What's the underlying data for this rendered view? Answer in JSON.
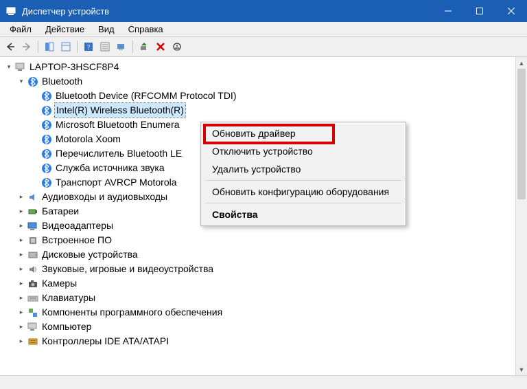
{
  "window": {
    "title": "Диспетчер устройств"
  },
  "menu": {
    "file": "Файл",
    "action": "Действие",
    "view": "Вид",
    "help": "Справка"
  },
  "tree": {
    "root": "LAPTOP-3HSCF8P4",
    "bluetooth": {
      "label": "Bluetooth",
      "children": [
        "Bluetooth Device (RFCOMM Protocol TDI)",
        "Intel(R) Wireless Bluetooth(R)",
        "Microsoft Bluetooth Enumera",
        "Motorola Xoom",
        "Перечислитель Bluetooth LE",
        "Служба источника звука",
        "Транспорт AVRCP Motorola"
      ]
    },
    "categories": [
      "Аудиовходы и аудиовыходы",
      "Батареи",
      "Видеоадаптеры",
      "Встроенное ПО",
      "Дисковые устройства",
      "Звуковые, игровые и видеоустройства",
      "Камеры",
      "Клавиатуры",
      "Компоненты программного обеспечения",
      "Компьютер",
      "Контроллеры IDE ATA/ATAPI"
    ]
  },
  "context_menu": {
    "update_driver": "Обновить драйвер",
    "disable_device": "Отключить устройство",
    "uninstall_device": "Удалить устройство",
    "scan_hardware": "Обновить конфигурацию оборудования",
    "properties": "Свойства"
  }
}
